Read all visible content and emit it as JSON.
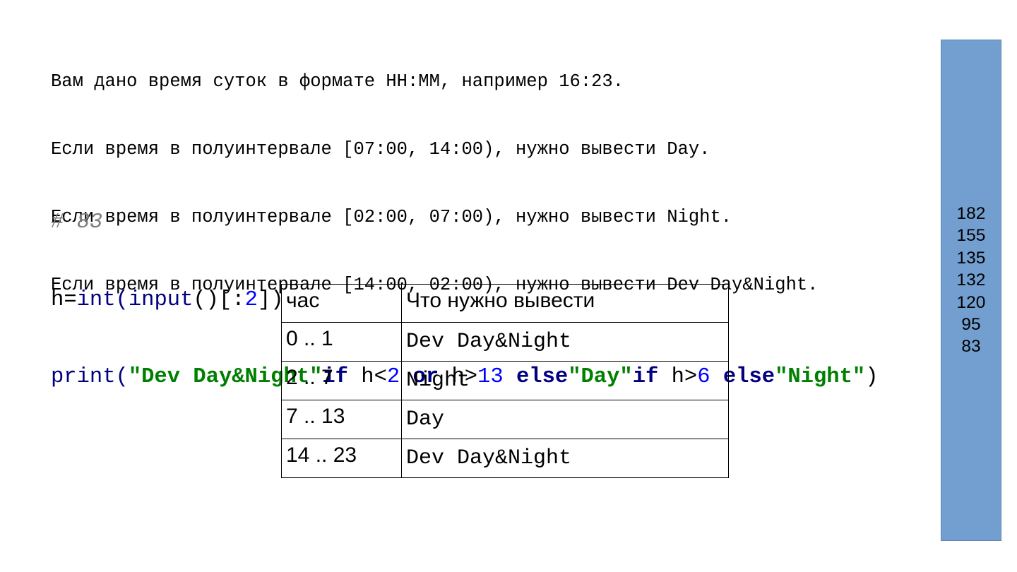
{
  "task_lines": [
    "Вам дано время суток в формате HH:MM, например 16:23.",
    "Если время в полуинтервале [07:00, 14:00), нужно вывести Day.",
    "Если время в полуинтервале [02:00, 07:00), нужно вывести Night.",
    "Если время в полуинтервале [14:00, 02:00), нужно вывести Dev Day&Night."
  ],
  "code": {
    "comment": "# 83",
    "line1": {
      "var": "h",
      "eq": "=",
      "fn_int": "int",
      "open1": "(",
      "fn_input": "input",
      "call": "()[:",
      "num": "2",
      "close1": "])"
    },
    "line2": {
      "fn_print": "print",
      "open": "(",
      "str1": "\"Dev Day&Night\"",
      "kw_if1": "if",
      "cond1a": " h<",
      "num1": "2",
      "kw_or": " or",
      "cond1b": " h>",
      "num2": "13",
      "kw_else1": " else",
      "str2": "\"Day\"",
      "kw_if2": "if",
      "cond2": " h>",
      "num3": "6",
      "kw_else2": " else",
      "str3": "\"Night\"",
      "close": ")"
    }
  },
  "table": {
    "header": [
      "час",
      "Что нужно вывести"
    ],
    "rows": [
      [
        "0 .. 1",
        "Dev Day&Night"
      ],
      [
        "2 .. 7",
        "Night"
      ],
      [
        "7 .. 13",
        "Day"
      ],
      [
        "14 .. 23",
        "Dev Day&Night"
      ]
    ]
  },
  "sidebar": {
    "values": [
      "182",
      "155",
      "135",
      "132",
      "120",
      "95",
      "83"
    ],
    "color": "#729fcf"
  },
  "colors": {
    "comment": "#808080",
    "builtin": "#000080",
    "string": "#008000",
    "number": "#0000ff"
  }
}
